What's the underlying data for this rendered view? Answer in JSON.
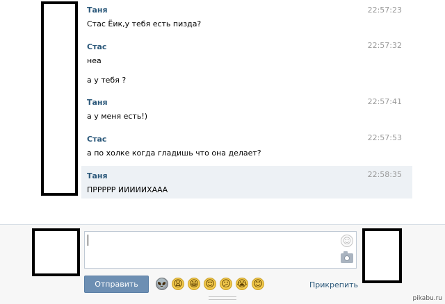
{
  "messages": [
    {
      "author": "Таня",
      "time": "22:57:23",
      "lines": [
        "Стас Ёик,у тебя есть пизда?"
      ],
      "unread": false
    },
    {
      "author": "Стас",
      "time": "22:57:32",
      "lines": [
        "неа",
        "а у тебя ?"
      ],
      "unread": false
    },
    {
      "author": "Таня",
      "time": "22:57:41",
      "lines": [
        "а у меня есть!)"
      ],
      "unread": false
    },
    {
      "author": "Стас",
      "time": "22:57:53",
      "lines": [
        "а по холке когда гладишь что она делает?"
      ],
      "unread": false
    },
    {
      "author": "Таня",
      "time": "22:58:35",
      "lines": [
        "ПРРРРР ИИИИИХААА"
      ],
      "unread": true
    }
  ],
  "composer": {
    "input_value": "",
    "send_label": "Отправить",
    "attach_label": "Прикрепить",
    "emojis": [
      "alien-face",
      "weary-face",
      "grinning-face",
      "relieved-face",
      "confused-face",
      "crying-face",
      "smiling-face"
    ]
  },
  "colors": {
    "author_name": "#2b587a",
    "timestamp": "#999999",
    "unread_bg": "#edf1f5",
    "send_button": "#6d8fb3"
  },
  "watermark": "pikabu.ru"
}
